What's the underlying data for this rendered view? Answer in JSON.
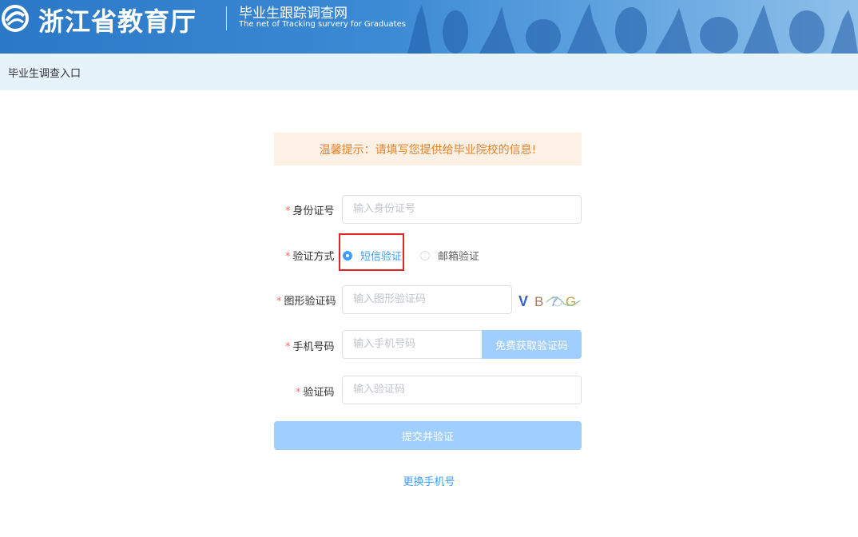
{
  "header": {
    "org_name": "浙江省教育厅",
    "site_name": "毕业生跟踪调查网",
    "site_subtitle": "The net of Tracking survery for Graduates"
  },
  "breadcrumb": {
    "label": "毕业生调查入口"
  },
  "tip": {
    "text": "温馨提示：请填写您提供给毕业院校的信息!"
  },
  "form": {
    "required_mark": "*",
    "id_card": {
      "label": "身份证号",
      "placeholder": "输入身份证号",
      "value": ""
    },
    "verify_method": {
      "label": "验证方式",
      "options": [
        {
          "label": "短信验证",
          "selected": true
        },
        {
          "label": "邮箱验证",
          "selected": false
        }
      ]
    },
    "captcha": {
      "label": "图形验证码",
      "placeholder": "输入图形验证码",
      "image_text": "VB7G"
    },
    "phone": {
      "label": "手机号码",
      "placeholder": "输入手机号码",
      "send_code_label": "免费获取验证码"
    },
    "code": {
      "label": "验证码",
      "placeholder": "输入验证码"
    },
    "submit_label": "提交并验证",
    "change_phone_label": "更换手机号"
  },
  "colors": {
    "primary": "#409eff",
    "primary_disabled": "#a0cfff",
    "required": "#f56c6c",
    "tip_bg": "#fdf0e4",
    "tip_text": "#e6832e",
    "highlight": "#e02424"
  }
}
